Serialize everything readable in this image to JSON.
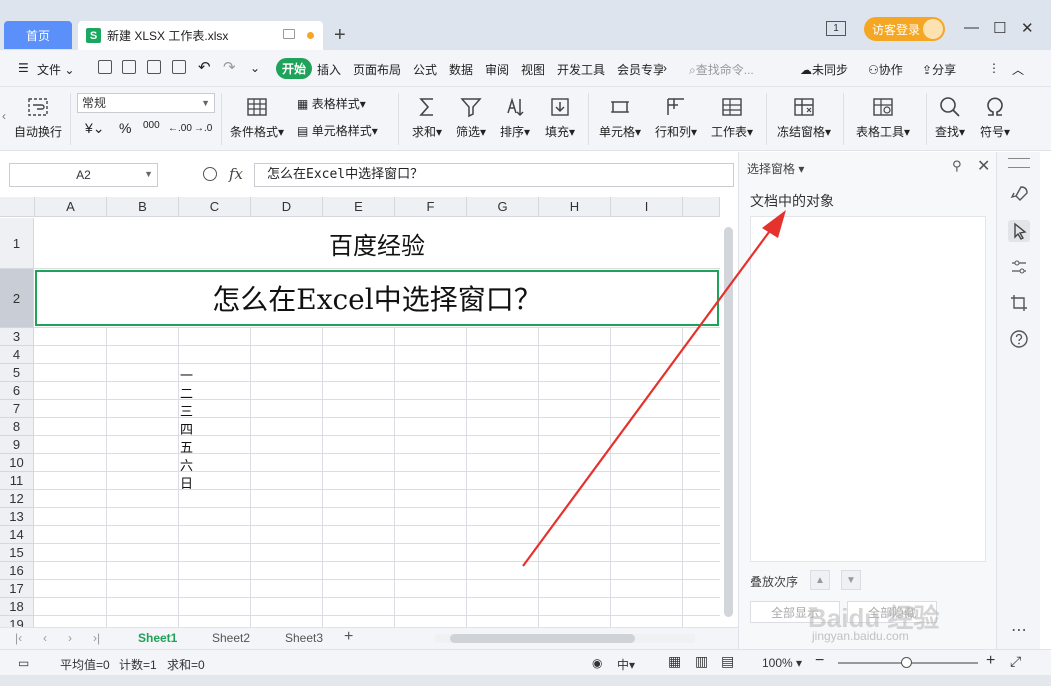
{
  "titlebar": {
    "home_tab": "首页",
    "doc_tab": "新建 XLSX 工作表.xlsx",
    "doc_icon_letter": "S",
    "window_count": "1",
    "login_label": "访客登录"
  },
  "menu": {
    "file": "文件",
    "start": "开始",
    "items": [
      "插入",
      "页面布局",
      "公式",
      "数据",
      "审阅",
      "视图",
      "开发工具",
      "会员专享"
    ],
    "search_placeholder": "查找命令...",
    "sync": "未同步",
    "collab": "协作",
    "share": "分享"
  },
  "toolbar": {
    "wrap_text": "自动换行",
    "number_format": "常规",
    "currency": "¥",
    "percent": "%",
    "thousands": "000",
    "dec_increase": ".00",
    "dec_decrease": ".0",
    "cond_format": "条件格式",
    "table_style": "表格样式",
    "cell_style": "单元格样式",
    "sum": "求和",
    "filter": "筛选",
    "sort": "排序",
    "fill": "填充",
    "cell": "单元格",
    "row_col": "行和列",
    "worksheet": "工作表",
    "freeze": "冻结窗格",
    "table_tools": "表格工具",
    "find": "查找",
    "symbol": "符号"
  },
  "formula": {
    "name_box": "A2",
    "fx": "fx",
    "content": "怎么在Excel中选择窗口？"
  },
  "grid": {
    "columns": [
      "A",
      "B",
      "C",
      "D",
      "E",
      "F",
      "G",
      "H",
      "I"
    ],
    "rows": [
      "1",
      "2",
      "3",
      "4",
      "5",
      "6",
      "7",
      "8",
      "9",
      "10",
      "11",
      "12",
      "13",
      "14",
      "15",
      "16",
      "17",
      "18",
      "19"
    ],
    "title_cell": "百度经验",
    "question_cell": "怎么在Excel中选择窗口？",
    "c_column": [
      "一",
      "二",
      "三",
      "四",
      "五",
      "六",
      "日"
    ]
  },
  "sheets": {
    "tabs": [
      "Sheet1",
      "Sheet2",
      "Sheet3"
    ],
    "active": "Sheet1"
  },
  "status": {
    "average": "平均值=0",
    "count": "计数=1",
    "sum": "求和=0",
    "zoom": "100%"
  },
  "pane": {
    "title": "选择窗格",
    "subtitle": "文档中的对象",
    "order": "叠放次序",
    "show_all": "全部显示",
    "hide_all": "全部隐藏"
  },
  "watermark": {
    "brand": "Baidu 经验",
    "url": "jingyan.baidu.com"
  },
  "colors": {
    "accent_green": "#1fa259",
    "tab_blue": "#5b8ff9",
    "login_orange": "#f5a623",
    "annotation_red": "#e5322d"
  }
}
